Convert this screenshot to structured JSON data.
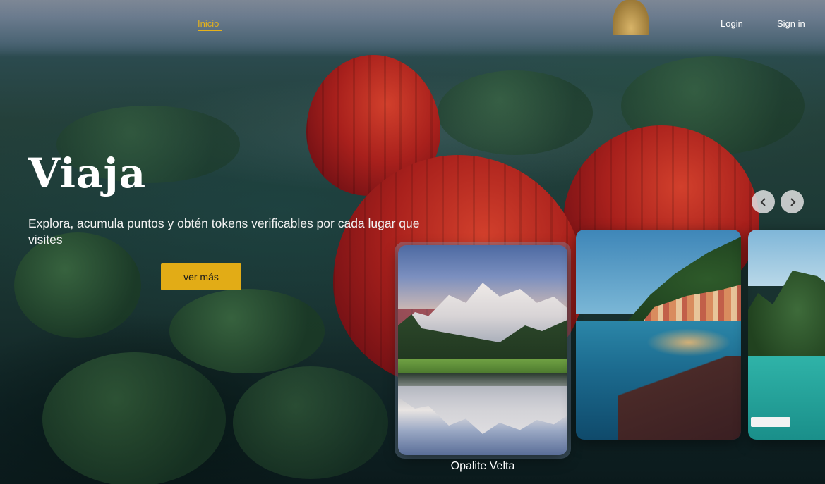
{
  "nav": {
    "home_label": "Inicio",
    "login_label": "Login",
    "signin_label": "Sign in",
    "accent": "#e6b21a"
  },
  "hero": {
    "title": "Viaja",
    "subtitle": "Explora, acumula puntos y obtén tokens verificables  por cada lugar que visites",
    "cta_label": "ver más",
    "cta_color": "#e2ac16"
  },
  "carousel": {
    "prev_icon": "chevron-left-icon",
    "next_icon": "chevron-right-icon",
    "cards": [
      {
        "scene": "snowy-mountain-lake",
        "caption": "Opalite Velta"
      },
      {
        "scene": "coastal-town-dusk",
        "caption": ""
      },
      {
        "scene": "karst-bay",
        "caption": ""
      }
    ]
  }
}
